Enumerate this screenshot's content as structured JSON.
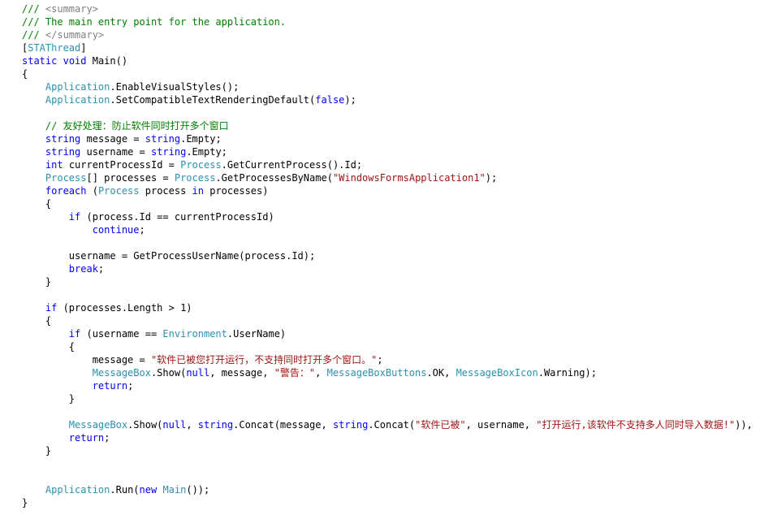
{
  "editor": {
    "lines": [
      [
        {
          "t": "/// ",
          "k": "comment"
        },
        {
          "t": "<summary>",
          "k": "doc"
        }
      ],
      [
        {
          "t": "/// The main entry point for the application.",
          "k": "comment"
        }
      ],
      [
        {
          "t": "/// ",
          "k": "comment"
        },
        {
          "t": "</summary>",
          "k": "doc"
        }
      ],
      [
        {
          "t": "[",
          "k": "plain"
        },
        {
          "t": "STAThread",
          "k": "type"
        },
        {
          "t": "]",
          "k": "plain"
        }
      ],
      [
        {
          "t": "static",
          "k": "keyword"
        },
        {
          "t": " ",
          "k": "plain"
        },
        {
          "t": "void",
          "k": "keyword"
        },
        {
          "t": " Main()",
          "k": "plain"
        }
      ],
      [
        {
          "t": "{",
          "k": "plain"
        }
      ],
      [
        {
          "t": "    ",
          "k": "plain"
        },
        {
          "t": "Application",
          "k": "type"
        },
        {
          "t": ".EnableVisualStyles();",
          "k": "plain"
        }
      ],
      [
        {
          "t": "    ",
          "k": "plain"
        },
        {
          "t": "Application",
          "k": "type"
        },
        {
          "t": ".SetCompatibleTextRenderingDefault(",
          "k": "plain"
        },
        {
          "t": "false",
          "k": "keyword"
        },
        {
          "t": ");",
          "k": "plain"
        }
      ],
      [],
      [
        {
          "t": "    // 友好处理：防止软件同时打开多个窗口",
          "k": "comment"
        }
      ],
      [
        {
          "t": "    ",
          "k": "plain"
        },
        {
          "t": "string",
          "k": "keyword"
        },
        {
          "t": " message = ",
          "k": "plain"
        },
        {
          "t": "string",
          "k": "keyword"
        },
        {
          "t": ".Empty;",
          "k": "plain"
        }
      ],
      [
        {
          "t": "    ",
          "k": "plain"
        },
        {
          "t": "string",
          "k": "keyword"
        },
        {
          "t": " username = ",
          "k": "plain"
        },
        {
          "t": "string",
          "k": "keyword"
        },
        {
          "t": ".Empty;",
          "k": "plain"
        }
      ],
      [
        {
          "t": "    ",
          "k": "plain"
        },
        {
          "t": "int",
          "k": "keyword"
        },
        {
          "t": " currentProcessId = ",
          "k": "plain"
        },
        {
          "t": "Process",
          "k": "type"
        },
        {
          "t": ".GetCurrentProcess().Id;",
          "k": "plain"
        }
      ],
      [
        {
          "t": "    ",
          "k": "plain"
        },
        {
          "t": "Process",
          "k": "type"
        },
        {
          "t": "[] processes = ",
          "k": "plain"
        },
        {
          "t": "Process",
          "k": "type"
        },
        {
          "t": ".GetProcessesByName(",
          "k": "plain"
        },
        {
          "t": "\"WindowsFormsApplication1\"",
          "k": "string"
        },
        {
          "t": ");",
          "k": "plain"
        }
      ],
      [
        {
          "t": "    ",
          "k": "plain"
        },
        {
          "t": "foreach",
          "k": "keyword"
        },
        {
          "t": " (",
          "k": "plain"
        },
        {
          "t": "Process",
          "k": "type"
        },
        {
          "t": " process ",
          "k": "plain"
        },
        {
          "t": "in",
          "k": "keyword"
        },
        {
          "t": " processes)",
          "k": "plain"
        }
      ],
      [
        {
          "t": "    {",
          "k": "plain"
        }
      ],
      [
        {
          "t": "        ",
          "k": "plain"
        },
        {
          "t": "if",
          "k": "keyword"
        },
        {
          "t": " (process.Id == currentProcessId)",
          "k": "plain"
        }
      ],
      [
        {
          "t": "            ",
          "k": "plain"
        },
        {
          "t": "continue",
          "k": "keyword"
        },
        {
          "t": ";",
          "k": "plain"
        }
      ],
      [],
      [
        {
          "t": "        username = GetProcessUserName(process.Id);",
          "k": "plain"
        }
      ],
      [
        {
          "t": "        ",
          "k": "plain"
        },
        {
          "t": "break",
          "k": "keyword"
        },
        {
          "t": ";",
          "k": "plain"
        }
      ],
      [
        {
          "t": "    }",
          "k": "plain"
        }
      ],
      [],
      [
        {
          "t": "    ",
          "k": "plain"
        },
        {
          "t": "if",
          "k": "keyword"
        },
        {
          "t": " (processes.Length > 1)",
          "k": "plain"
        }
      ],
      [
        {
          "t": "    {",
          "k": "plain"
        }
      ],
      [
        {
          "t": "        ",
          "k": "plain"
        },
        {
          "t": "if",
          "k": "keyword"
        },
        {
          "t": " (username == ",
          "k": "plain"
        },
        {
          "t": "Environment",
          "k": "type"
        },
        {
          "t": ".UserName)",
          "k": "plain"
        }
      ],
      [
        {
          "t": "        {",
          "k": "plain"
        }
      ],
      [
        {
          "t": "            message = ",
          "k": "plain"
        },
        {
          "t": "\"软件已被您打开运行，不支持同时打开多个窗口。\"",
          "k": "string"
        },
        {
          "t": ";",
          "k": "plain"
        }
      ],
      [
        {
          "t": "            ",
          "k": "plain"
        },
        {
          "t": "MessageBox",
          "k": "type"
        },
        {
          "t": ".Show(",
          "k": "plain"
        },
        {
          "t": "null",
          "k": "keyword"
        },
        {
          "t": ", message, ",
          "k": "plain"
        },
        {
          "t": "\"警告：\"",
          "k": "string"
        },
        {
          "t": ", ",
          "k": "plain"
        },
        {
          "t": "MessageBoxButtons",
          "k": "type"
        },
        {
          "t": ".OK, ",
          "k": "plain"
        },
        {
          "t": "MessageBoxIcon",
          "k": "type"
        },
        {
          "t": ".Warning);",
          "k": "plain"
        }
      ],
      [
        {
          "t": "            ",
          "k": "plain"
        },
        {
          "t": "return",
          "k": "keyword"
        },
        {
          "t": ";",
          "k": "plain"
        }
      ],
      [
        {
          "t": "        }",
          "k": "plain"
        }
      ],
      [],
      [
        {
          "t": "        ",
          "k": "plain"
        },
        {
          "t": "MessageBox",
          "k": "type"
        },
        {
          "t": ".Show(",
          "k": "plain"
        },
        {
          "t": "null",
          "k": "keyword"
        },
        {
          "t": ", ",
          "k": "plain"
        },
        {
          "t": "string",
          "k": "keyword"
        },
        {
          "t": ".Concat(message, ",
          "k": "plain"
        },
        {
          "t": "string",
          "k": "keyword"
        },
        {
          "t": ".Concat(",
          "k": "plain"
        },
        {
          "t": "\"软件已被\"",
          "k": "string"
        },
        {
          "t": ", username, ",
          "k": "plain"
        },
        {
          "t": "\"打开运行,该软件不支持多人同时导入数据!\"",
          "k": "string"
        },
        {
          "t": ")),",
          "k": "plain"
        }
      ],
      [
        {
          "t": "        ",
          "k": "plain"
        },
        {
          "t": "return",
          "k": "keyword"
        },
        {
          "t": ";",
          "k": "plain"
        }
      ],
      [
        {
          "t": "    }",
          "k": "plain"
        }
      ],
      [],
      [],
      [
        {
          "t": "    ",
          "k": "plain"
        },
        {
          "t": "Application",
          "k": "type"
        },
        {
          "t": ".Run(",
          "k": "plain"
        },
        {
          "t": "new",
          "k": "keyword"
        },
        {
          "t": " ",
          "k": "plain"
        },
        {
          "t": "Main",
          "k": "type"
        },
        {
          "t": "());",
          "k": "plain"
        }
      ],
      [
        {
          "t": "}",
          "k": "plain"
        }
      ]
    ]
  },
  "colors": {
    "comment": "#008000",
    "doc": "#808080",
    "keyword": "#0000ff",
    "type": "#2b91af",
    "string": "#a31515",
    "plain": "#000000",
    "background": "#ffffff"
  }
}
